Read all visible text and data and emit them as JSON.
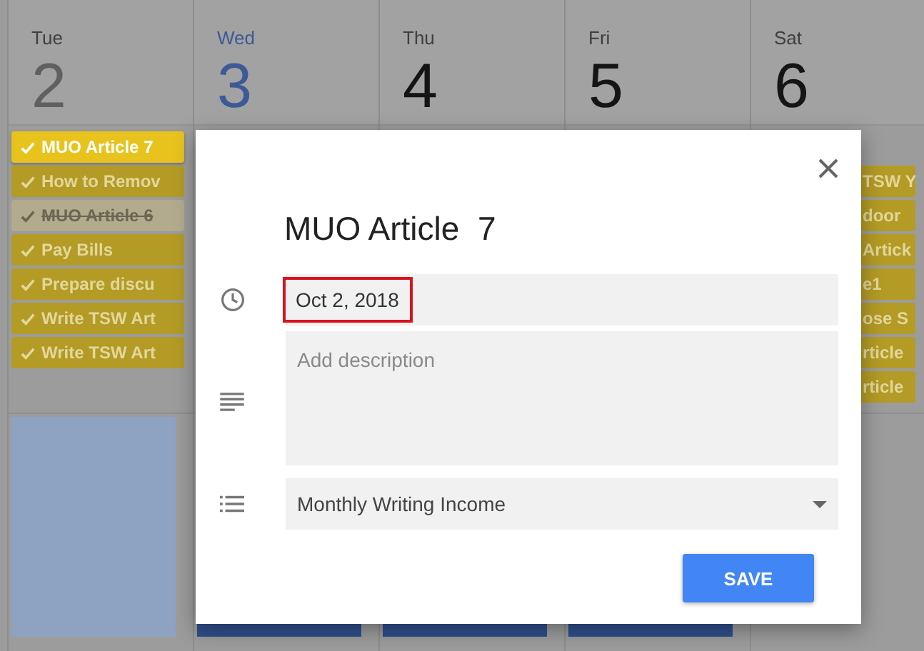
{
  "days": [
    {
      "weekday": "Tue",
      "date": "2",
      "today": false,
      "past": true,
      "tasks": [
        {
          "title": "MUO Article 7",
          "selected": true,
          "completed": false
        },
        {
          "title": "How to Remov",
          "selected": false,
          "completed": false
        },
        {
          "title": "MUO Article 6",
          "selected": false,
          "completed": true
        },
        {
          "title": "Pay Bills",
          "selected": false,
          "completed": false
        },
        {
          "title": "Prepare discu",
          "selected": false,
          "completed": false
        },
        {
          "title": "Write TSW Art",
          "selected": false,
          "completed": false
        },
        {
          "title": "Write TSW Art",
          "selected": false,
          "completed": false
        }
      ],
      "events": [
        {
          "kind": "tall"
        }
      ]
    },
    {
      "weekday": "Wed",
      "date": "3",
      "today": true,
      "past": false,
      "events": [
        {
          "kind": "short"
        }
      ]
    },
    {
      "weekday": "Thu",
      "date": "4",
      "today": false,
      "past": false,
      "events": [
        {
          "kind": "short"
        }
      ]
    },
    {
      "weekday": "Fri",
      "date": "5",
      "today": false,
      "past": false,
      "events": [
        {
          "kind": "short"
        }
      ]
    },
    {
      "weekday": "Sat",
      "date": "6",
      "today": false,
      "past": false,
      "tasks": [
        {
          "title": "TSW Y",
          "selected": false,
          "completed": false
        },
        {
          "title": "door",
          "selected": false,
          "completed": false
        },
        {
          "title": "Artick",
          "selected": false,
          "completed": false
        },
        {
          "title": "e1",
          "selected": false,
          "completed": false
        },
        {
          "title": "ose S",
          "selected": false,
          "completed": false
        },
        {
          "title": "rticle",
          "selected": false,
          "completed": false
        },
        {
          "title": "rticle",
          "selected": false,
          "completed": false
        }
      ]
    }
  ],
  "dialog": {
    "title": "MUO Article  7",
    "date": "Oct 2, 2018",
    "date_highlighted": true,
    "description": {
      "placeholder": "Add description"
    },
    "list": {
      "value": "Monthly Writing Income"
    },
    "save": "SAVE"
  }
}
